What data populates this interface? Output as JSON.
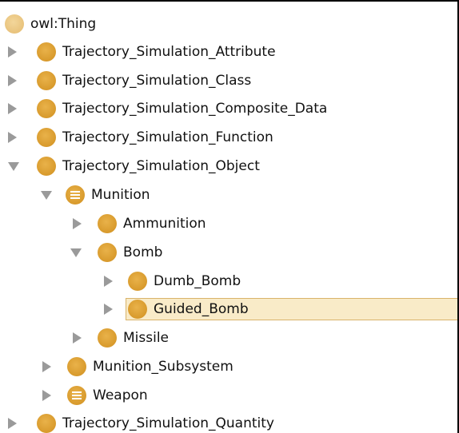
{
  "tree": {
    "root": {
      "label": "owl:Thing"
    },
    "nodes": [
      {
        "id": "n1",
        "label": "Trajectory_Simulation_Attribute",
        "expander": "collapsed"
      },
      {
        "id": "n2",
        "label": "Trajectory_Simulation_Class",
        "expander": "collapsed"
      },
      {
        "id": "n3",
        "label": "Trajectory_Simulation_Composite_Data",
        "expander": "collapsed"
      },
      {
        "id": "n4",
        "label": "Trajectory_Simulation_Function",
        "expander": "collapsed"
      },
      {
        "id": "n5",
        "label": "Trajectory_Simulation_Object",
        "expander": "expanded"
      },
      {
        "id": "n6",
        "label": "Munition",
        "expander": "expanded",
        "icon": "equivalent-class-icon"
      },
      {
        "id": "n7",
        "label": "Ammunition",
        "expander": "collapsed"
      },
      {
        "id": "n8",
        "label": "Bomb",
        "expander": "expanded"
      },
      {
        "id": "n9",
        "label": "Dumb_Bomb",
        "expander": "collapsed"
      },
      {
        "id": "n10",
        "label": "Guided_Bomb",
        "expander": "collapsed",
        "selected": true
      },
      {
        "id": "n11",
        "label": "Missile",
        "expander": "collapsed"
      },
      {
        "id": "n12",
        "label": "Munition_Subsystem",
        "expander": "collapsed"
      },
      {
        "id": "n13",
        "label": "Weapon",
        "expander": "collapsed",
        "icon": "equivalent-class-icon"
      },
      {
        "id": "n14",
        "label": "Trajectory_Simulation_Quantity",
        "expander": "collapsed"
      }
    ]
  },
  "colors": {
    "class_icon": "#d89a2c",
    "thing_icon": "#e7c078",
    "selection_bg": "#f9ebc8",
    "selection_border": "#d9b36a",
    "expander": "#9a9a9a"
  }
}
